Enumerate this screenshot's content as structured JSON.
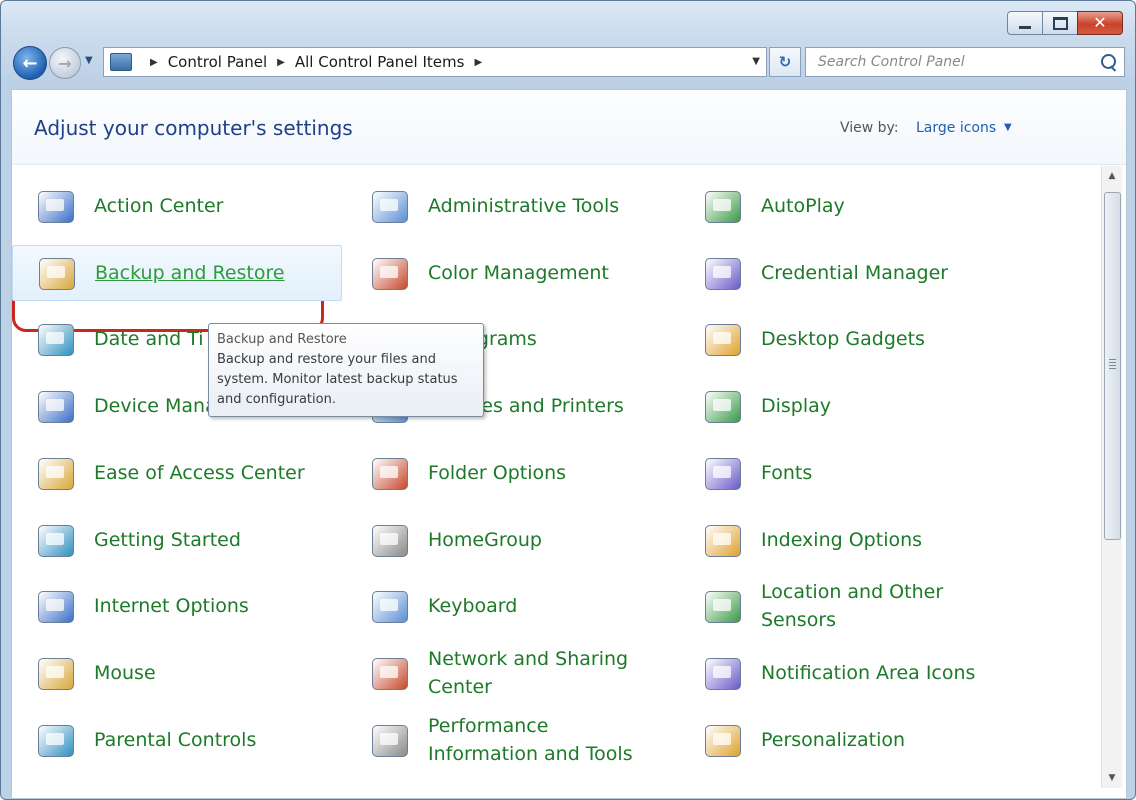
{
  "window": {
    "caption_buttons": [
      "minimize",
      "maximize",
      "close"
    ]
  },
  "nav": {
    "breadcrumb": [
      "Control Panel",
      "All Control Panel Items"
    ],
    "search_placeholder": "Search Control Panel"
  },
  "header": {
    "title": "Adjust your computer's settings",
    "view_by_label": "View by:",
    "view_by_value": "Large icons"
  },
  "items": [
    {
      "label": "Action Center",
      "icon": "flag-icon"
    },
    {
      "label": "Administrative Tools",
      "icon": "admin-tools-icon"
    },
    {
      "label": "AutoPlay",
      "icon": "autoplay-icon"
    },
    {
      "label": "Backup and Restore",
      "icon": "backup-icon",
      "highlighted": true
    },
    {
      "label": "Color Management",
      "icon": "color-management-icon"
    },
    {
      "label": "Credential Manager",
      "icon": "vault-icon"
    },
    {
      "label": "Date and Ti",
      "icon": "calendar-clock-icon"
    },
    {
      "label": "lt Programs",
      "icon": "default-programs-icon"
    },
    {
      "label": "Desktop Gadgets",
      "icon": "gadgets-icon"
    },
    {
      "label": "Device Manager",
      "icon": "device-manager-icon"
    },
    {
      "label": "Devices and Printers",
      "icon": "printer-icon"
    },
    {
      "label": "Display",
      "icon": "monitor-icon"
    },
    {
      "label": "Ease of Access Center",
      "icon": "accessibility-icon"
    },
    {
      "label": "Folder Options",
      "icon": "folder-icon"
    },
    {
      "label": "Fonts",
      "icon": "fonts-icon"
    },
    {
      "label": "Getting Started",
      "icon": "getting-started-icon"
    },
    {
      "label": "HomeGroup",
      "icon": "homegroup-icon"
    },
    {
      "label": "Indexing Options",
      "icon": "indexing-icon"
    },
    {
      "label": "Internet Options",
      "icon": "globe-icon"
    },
    {
      "label": "Keyboard",
      "icon": "keyboard-icon"
    },
    {
      "label": "Location and Other Sensors",
      "icon": "sensors-icon"
    },
    {
      "label": "Mouse",
      "icon": "mouse-icon"
    },
    {
      "label": "Network and Sharing Center",
      "icon": "network-icon"
    },
    {
      "label": "Notification Area Icons",
      "icon": "notification-icon"
    },
    {
      "label": "Parental Controls",
      "icon": "parental-icon"
    },
    {
      "label": "Performance Information and Tools",
      "icon": "performance-icon"
    },
    {
      "label": "Personalization",
      "icon": "personalization-icon"
    }
  ],
  "tooltip": {
    "title": "Backup and Restore",
    "text": "Backup and restore your files and system. Monitor latest backup status and configuration."
  }
}
